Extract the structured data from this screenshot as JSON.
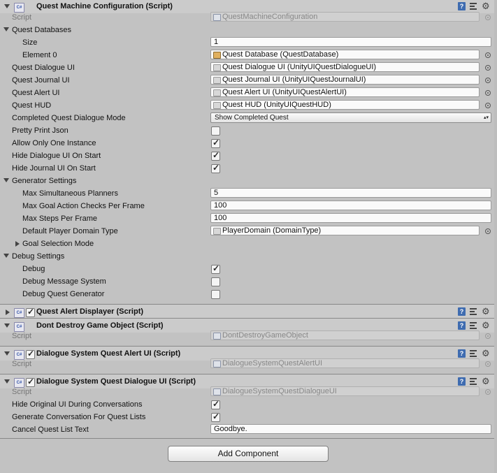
{
  "components": {
    "quest_machine": {
      "title": "Quest Machine Configuration (Script)",
      "script_label": "Script",
      "script_value": "QuestMachineConfiguration",
      "quest_databases": "Quest Databases",
      "size_label": "Size",
      "size_value": "1",
      "element0_label": "Element 0",
      "element0_value": "Quest Database (QuestDatabase)",
      "dialogue_ui_label": "Quest Dialogue UI",
      "dialogue_ui_value": "Quest Dialogue UI (UnityUIQuestDialogueUI)",
      "journal_ui_label": "Quest Journal UI",
      "journal_ui_value": "Quest Journal UI (UnityUIQuestJournalUI)",
      "alert_ui_label": "Quest Alert UI",
      "alert_ui_value": "Quest Alert UI (UnityUIQuestAlertUI)",
      "hud_label": "Quest HUD",
      "hud_value": "Quest HUD (UnityUIQuestHUD)",
      "completed_mode_label": "Completed Quest Dialogue Mode",
      "completed_mode_value": "Show Completed Quest",
      "pretty_print_label": "Pretty Print Json",
      "pretty_print_checked": false,
      "allow_one_label": "Allow Only One Instance",
      "allow_one_checked": true,
      "hide_dialogue_label": "Hide Dialogue UI On Start",
      "hide_dialogue_checked": true,
      "hide_journal_label": "Hide Journal UI On Start",
      "hide_journal_checked": true,
      "generator_settings": "Generator Settings",
      "max_planners_label": "Max Simultaneous Planners",
      "max_planners_value": "5",
      "max_goal_label": "Max Goal Action Checks Per Frame",
      "max_goal_value": "100",
      "max_steps_label": "Max Steps Per Frame",
      "max_steps_value": "100",
      "domain_type_label": "Default Player Domain Type",
      "domain_type_value": "PlayerDomain (DomainType)",
      "goal_selection_label": "Goal Selection Mode",
      "debug_settings": "Debug Settings",
      "debug_label": "Debug",
      "debug_checked": true,
      "debug_msg_label": "Debug Message System",
      "debug_msg_checked": false,
      "debug_gen_label": "Debug Quest Generator",
      "debug_gen_checked": false
    },
    "quest_alert_displayer": {
      "title": "Quest Alert Displayer (Script)",
      "enabled": true
    },
    "dont_destroy": {
      "title": "Dont Destroy Game Object (Script)",
      "script_label": "Script",
      "script_value": "DontDestroyGameObject"
    },
    "ds_alert_ui": {
      "title": "Dialogue System Quest Alert UI (Script)",
      "enabled": true,
      "script_label": "Script",
      "script_value": "DialogueSystemQuestAlertUI"
    },
    "ds_dialogue_ui": {
      "title": "Dialogue System Quest Dialogue UI (Script)",
      "enabled": true,
      "script_label": "Script",
      "script_value": "DialogueSystemQuestDialogueUI",
      "hide_original_label": "Hide Original UI During Conversations",
      "hide_original_checked": true,
      "generate_conv_label": "Generate Conversation For Quest Lists",
      "generate_conv_checked": true,
      "cancel_text_label": "Cancel Quest List Text",
      "cancel_text_value": "Goodbye."
    }
  },
  "add_component_label": "Add Component",
  "icons": {
    "script": "cs-script-icon",
    "help": "help-icon",
    "preset": "preset-icon",
    "gear": "gear-icon",
    "picker": "object-picker-icon"
  }
}
